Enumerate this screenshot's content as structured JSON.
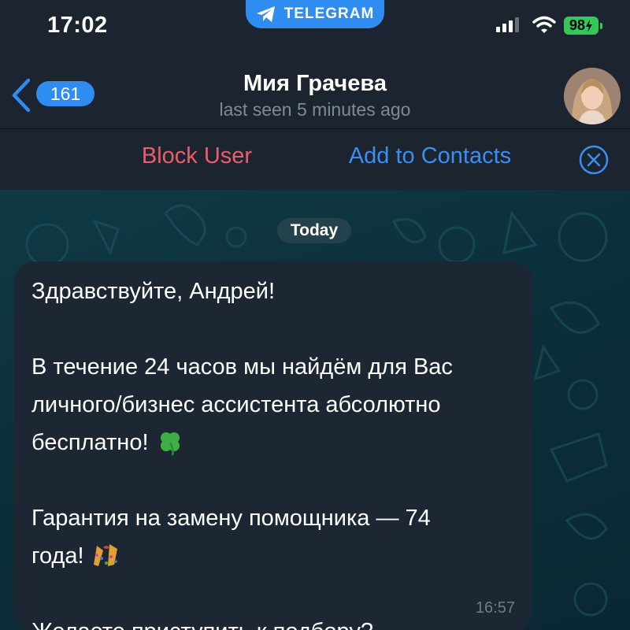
{
  "status_bar": {
    "time": "17:02",
    "app_pill": "TELEGRAM",
    "battery": "98"
  },
  "header": {
    "back_count": "161",
    "contact_name": "Мия Грачева",
    "last_seen": "last seen 5 minutes ago",
    "avatar_icon": "contact-avatar"
  },
  "action_bar": {
    "block_label": "Block User",
    "add_label": "Add to Contacts"
  },
  "chat": {
    "date_label": "Today",
    "message": {
      "lines": {
        "l1": "Здравствуйте, Андрей!",
        "l2": "В течение 24 часов мы найдём для Вас",
        "l3": "личного/бизнес ассистента абсолютно",
        "l4": "бесплатно!",
        "l5": "Гарантия на замену помощника — 74",
        "l6": "года!",
        "l7": "Желаете приступить к подбору?"
      },
      "emoji_1": "four-leaf-clover",
      "emoji_2": "confetti",
      "time": "16:57"
    }
  },
  "colors": {
    "accent": "#2f8cf0",
    "block_red": "#ec5d6b",
    "bubble_bg": "#1d2733",
    "header_bg": "#1c242f"
  }
}
